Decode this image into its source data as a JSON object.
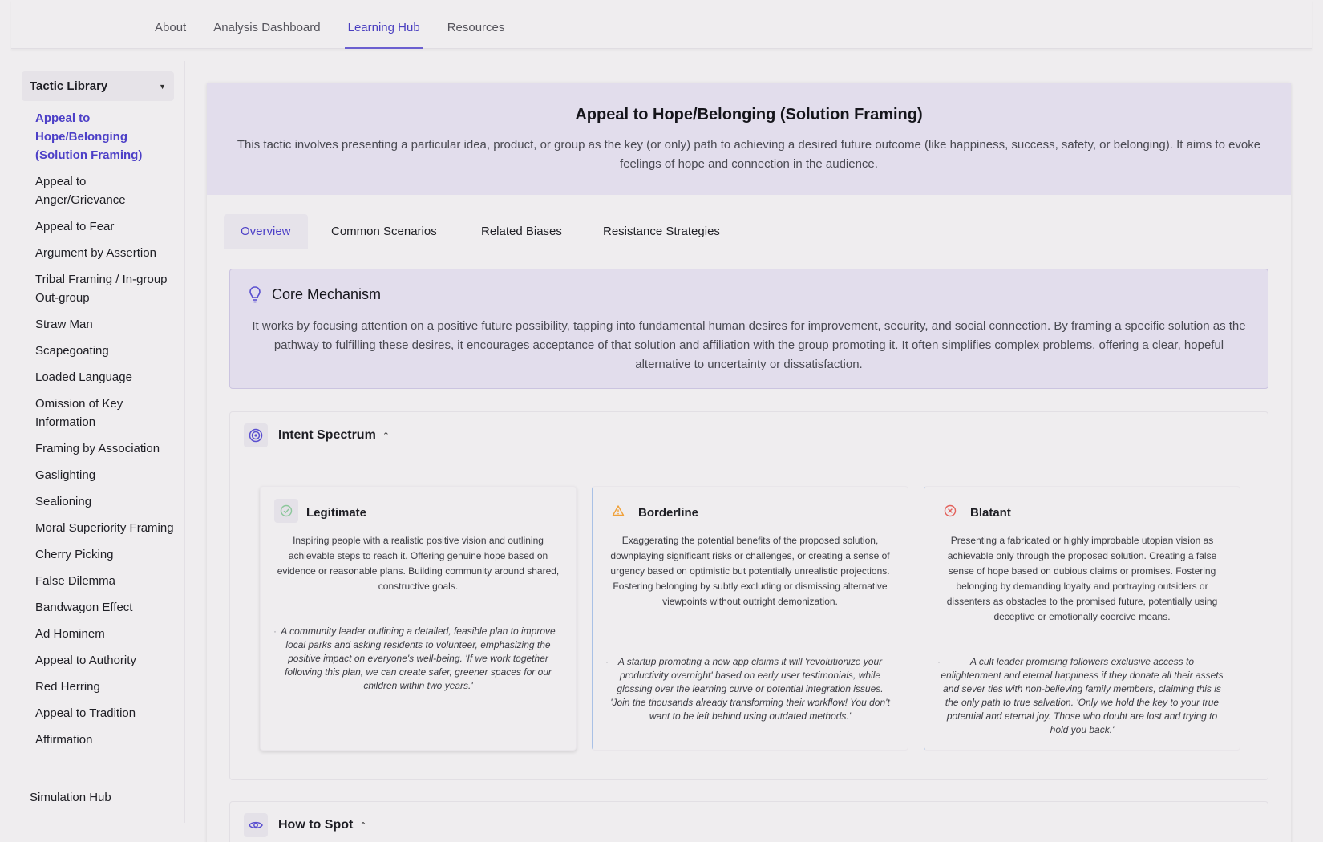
{
  "nav": {
    "tabs": [
      "About",
      "Analysis Dashboard",
      "Learning Hub",
      "Resources"
    ],
    "active_tab": "Learning Hub"
  },
  "sidebar": {
    "library_title": "Tactic Library",
    "tactics": [
      "Appeal to Hope/Belonging (Solution Framing)",
      "Appeal to Anger/Grievance",
      "Appeal to Fear",
      "Argument by Assertion",
      "Tribal Framing / In-group Out-group",
      "Straw Man",
      "Scapegoating",
      "Loaded Language",
      "Omission of Key Information",
      "Framing by Association",
      "Gaslighting",
      "Sealioning",
      "Moral Superiority Framing",
      "Cherry Picking",
      "False Dilemma",
      "Bandwagon Effect",
      "Ad Hominem",
      "Appeal to Authority",
      "Red Herring",
      "Appeal to Tradition",
      "Affirmation"
    ],
    "active_tactic": "Appeal to Hope/Belonging (Solution Framing)",
    "simulation_hub": "Simulation Hub"
  },
  "hero": {
    "title": "Appeal to Hope/Belonging (Solution Framing)",
    "description": "This tactic involves presenting a particular idea, product, or group as the key (or only) path to achieving a desired future outcome (like happiness, success, safety, or belonging). It aims to evoke feelings of hope and connection in the audience."
  },
  "sub_tabs": {
    "overview": "Overview",
    "scenarios": "Common Scenarios",
    "biases": "Related Biases",
    "resistance": "Resistance Strategies"
  },
  "core": {
    "title": "Core Mechanism",
    "text": "It works by focusing attention on a positive future possibility, tapping into fundamental human desires for improvement, security, and social connection. By framing a specific solution as the pathway to fulfilling these desires, it encourages acceptance of that solution and affiliation with the group promoting it. It often simplifies complex problems, offering a clear, hopeful alternative to uncertainty or dissatisfaction."
  },
  "intent": {
    "title": "Intent Spectrum",
    "legitimate": {
      "title": "Legitimate",
      "description": "Inspiring people with a realistic positive vision and outlining achievable steps to reach it. Offering genuine hope based on evidence or reasonable plans. Building community around shared, constructive goals.",
      "example": "A community leader outlining a detailed, feasible plan to improve local parks and asking residents to volunteer, emphasizing the positive impact on everyone's well-being. 'If we work together following this plan, we can create safer, greener spaces for our children within two years.'"
    },
    "borderline": {
      "title": "Borderline",
      "description": "Exaggerating the potential benefits of the proposed solution, downplaying significant risks or challenges, or creating a sense of urgency based on optimistic but potentially unrealistic projections. Fostering belonging by subtly excluding or dismissing alternative viewpoints without outright demonization.",
      "example": "A startup promoting a new app claims it will 'revolutionize your productivity overnight' based on early user testimonials, while glossing over the learning curve or potential integration issues. 'Join the thousands already transforming their workflow! You don't want to be left behind using outdated methods.'"
    },
    "blatant": {
      "title": "Blatant",
      "description": "Presenting a fabricated or highly improbable utopian vision as achievable only through the proposed solution. Creating a false sense of hope based on dubious claims or promises. Fostering belonging by demanding loyalty and portraying outsiders or dissenters as obstacles to the promised future, potentially using deceptive or emotionally coercive means.",
      "example": "A cult leader promising followers exclusive access to enlightenment and eternal happiness if they donate all their assets and sever ties with non-believing family members, claiming this is the only path to true salvation. 'Only we hold the key to your true potential and eternal joy. Those who doubt are lost and trying to hold you back.'"
    }
  },
  "how_to_spot": {
    "title": "How to Spot"
  },
  "colors": {
    "accent": "#4c3fc7",
    "hero_bg": "#e2ddec",
    "legit_icon": "#8bc79a",
    "borderline_icon": "#f0a13a",
    "blatant_icon": "#e3605a"
  }
}
